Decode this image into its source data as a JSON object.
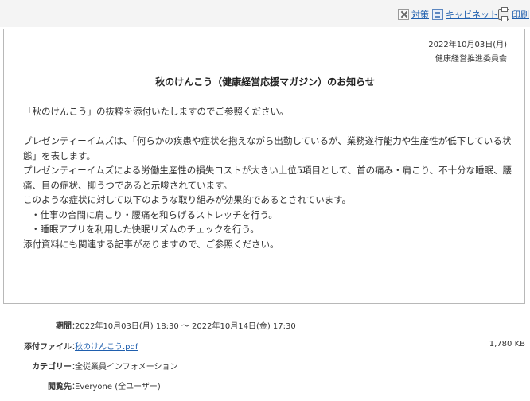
{
  "toolbar": {
    "unsubscribe_label": "対策",
    "cabinet_label": "キャビネット",
    "print_label": "印刷"
  },
  "message": {
    "date": "2022年10月03日(月)",
    "sender": "健康経営推進委員会",
    "title": "秋のけんこう（健康経営応援マガジン）のお知らせ",
    "body": {
      "intro": "「秋のけんこう」の抜粋を添付いたしますのでご参照ください。",
      "p1": "プレゼンティーイムズは、「何らかの疾患や症状を抱えながら出勤しているが、業務遂行能力や生産性が低下している状態」を表します。",
      "p2": "プレゼンティーイムズによる労働生産性の損失コストが大きい上位5項目として、首の痛み・肩こり、不十分な睡眠、腰痛、目の症状、抑うつであると示唆されています。",
      "p3": "このような症状に対して以下のような取り組みが効果的であるとされています。",
      "item1": "・仕事の合間に肩こり・腰痛を和らげるストレッチを行う。",
      "item2": "・睡眠アプリを利用した快眠リズムのチェックを行う。",
      "closing": "添付資料にも関連する記事がありますので、ご参照ください。"
    }
  },
  "details": {
    "period_label": "期間",
    "period_value": "2022年10月03日(月) 18:30 ～ 2022年10月14日(金) 17:30",
    "attachment_label": "添付ファイル",
    "attachment_name": "秋のけんこう.pdf",
    "attachment_size": "1,780 KB",
    "category_label": "カテゴリー",
    "category_value": "全従業員インフォメーション",
    "viewer_label": "閲覧先",
    "viewer_value": "Everyone (全ユーザー)",
    "colon": "："
  }
}
